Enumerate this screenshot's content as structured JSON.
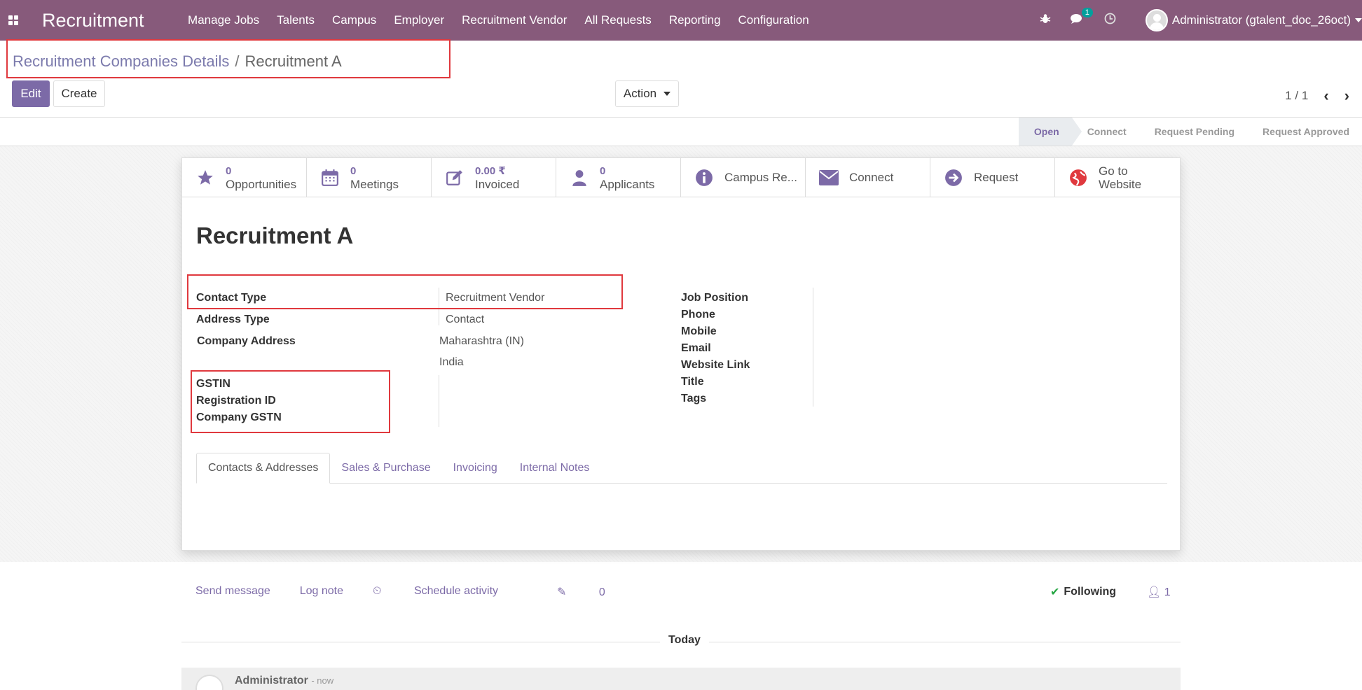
{
  "navbar": {
    "brand": "Recruitment",
    "menu": [
      "Manage Jobs",
      "Talents",
      "Campus",
      "Employer",
      "Recruitment Vendor",
      "All Requests",
      "Reporting",
      "Configuration"
    ],
    "messages_badge": "1",
    "user": "Administrator (gtalent_doc_26oct)"
  },
  "breadcrumb": {
    "parent": "Recruitment Companies Details",
    "separator": "/",
    "current": "Recruitment A"
  },
  "buttons": {
    "edit": "Edit",
    "create": "Create",
    "action": "Action"
  },
  "pager": {
    "value": "1 / 1"
  },
  "stages": [
    "Open",
    "Connect",
    "Request Pending",
    "Request Approved"
  ],
  "smart_buttons": [
    {
      "value": "0",
      "label": "Opportunities",
      "icon": "star-icon"
    },
    {
      "value": "0",
      "label": "Meetings",
      "icon": "calendar-icon"
    },
    {
      "value": "0.00 ₹",
      "label": "Invoiced",
      "icon": "pencil-square-icon"
    },
    {
      "value": "0",
      "label": "Applicants",
      "icon": "user-icon"
    },
    {
      "label": "Campus Re...",
      "icon": "info-icon"
    },
    {
      "label": "Connect",
      "icon": "envelope-icon"
    },
    {
      "label": "Request",
      "icon": "arrow-circle-icon"
    },
    {
      "line1": "Go to",
      "line2": "Website",
      "icon": "globe-icon"
    }
  ],
  "record": {
    "title": "Recruitment A",
    "left_fields": {
      "contact_type_label": "Contact Type",
      "contact_type_value": "Recruitment Vendor",
      "address_type_label": "Address Type",
      "address_type_value": "Contact",
      "company_address_label": "Company Address",
      "address_state": "Maharashtra (IN)",
      "address_country": "India",
      "gstin_label": "GSTIN",
      "registration_id_label": "Registration ID",
      "company_gstn_label": "Company GSTN"
    },
    "right_fields": [
      "Job Position",
      "Phone",
      "Mobile",
      "Email",
      "Website Link",
      "Title",
      "Tags"
    ]
  },
  "tabs": [
    "Contacts & Addresses",
    "Sales & Purchase",
    "Invoicing",
    "Internal Notes"
  ],
  "chatter": {
    "send_message": "Send message",
    "log_note": "Log note",
    "schedule_activity": "Schedule activity",
    "attachments": "0",
    "following": "Following",
    "followers": "1",
    "today": "Today",
    "message_author": "Administrator",
    "message_time": "- now"
  },
  "colors": {
    "navbar": "#875a7b",
    "accent": "#7c6aa7",
    "highlight": "#e0393e"
  }
}
